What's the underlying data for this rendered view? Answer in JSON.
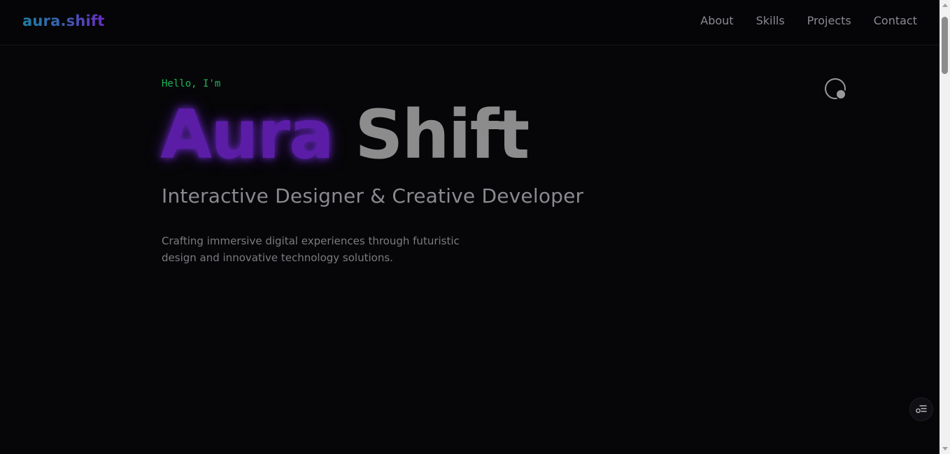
{
  "header": {
    "logo": "aura.shift",
    "nav": [
      {
        "label": "About"
      },
      {
        "label": "Skills"
      },
      {
        "label": "Projects"
      },
      {
        "label": "Contact"
      }
    ]
  },
  "hero": {
    "greeting": "Hello, I'm",
    "name_first": "Aura",
    "name_last": "Shift",
    "subtitle": "Interactive Designer & Creative Developer",
    "description": "Crafting immersive digital experiences through futuristic design and innovative technology solutions."
  },
  "icons": {
    "theme_toggle": "theme-toggle-icon",
    "floating_menu": "list-settings-icon"
  },
  "colors": {
    "background": "#060608",
    "greeting": "#1fb35a",
    "name_first": "#5b1da6",
    "name_last": "#8c8c8c",
    "text_muted": "#8a8a8e",
    "logo_gradient_start": "#1f7ea6",
    "logo_gradient_end": "#6a2dc7"
  }
}
